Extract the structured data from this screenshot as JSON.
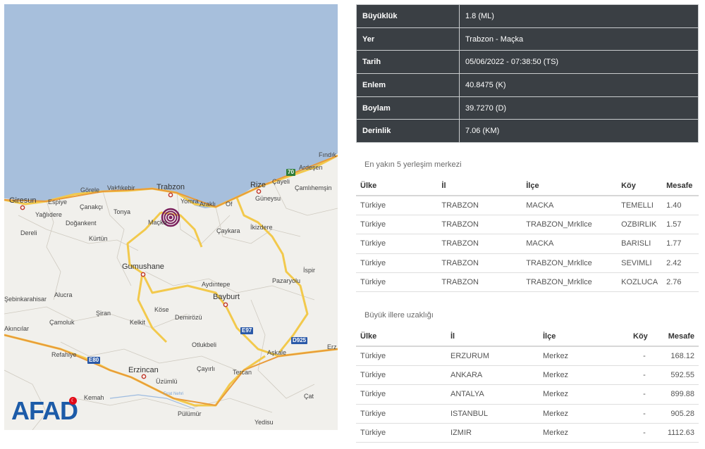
{
  "map": {
    "sea_color": "#a7bfdc",
    "land_color": "#f1f0ec",
    "epicenter_icon": "earthquake-epicenter-icon",
    "labels": {
      "findik": "Fındık",
      "ardesen": "Ardeşen",
      "rize": "Rize",
      "cayeli": "Çayeli",
      "camlihemsin": "Çamlıhemşin",
      "giresun": "Giresun",
      "espiye": "Espiye",
      "gorele": "Görele",
      "vakfikebir": "Vakfıkebir",
      "trabzon": "Trabzon",
      "yomra": "Yomra",
      "arakli": "Araklı",
      "of": "Of",
      "guneysu": "Güneysu",
      "canakci": "Çanakçı",
      "tonya": "Tonya",
      "yaglidere": "Yağlıdere",
      "dogankent": "Doğankent",
      "macka": "Maçka",
      "caykara": "Çaykara",
      "ikizdere": "İkizdere",
      "dereli": "Dereli",
      "kurtun": "Kürtün",
      "gumushane": "Gumushane",
      "ispir": "İspir",
      "sebinkarahisar": "Şebinkarahisar",
      "alucra": "Alucra",
      "aydintepe": "Aydıntepe",
      "pazaryolu": "Pazaryolu",
      "bayburt": "Bayburt",
      "siran": "Şiran",
      "kose": "Köse",
      "kelkit": "Kelkit",
      "demirozu": "Demirözü",
      "akincilar": "Akıncılar",
      "camoluk": "Çamoluk",
      "otlukbeli": "Otlukbeli",
      "refahiye": "Refahiye",
      "askale": "Aşkale",
      "erzincan": "Erzincan",
      "cayirli": "Çayırlı",
      "tercan": "Tercan",
      "uzumlu": "Üzümlü",
      "firat_nehri": "Fırat Nehri",
      "kemah": "Kemah",
      "cat": "Çat",
      "pulumur": "Pülümür",
      "yedisu": "Yedisu",
      "erz": "Erz"
    },
    "road_badges": {
      "r70": "70",
      "e97": "E97",
      "d925": "D925",
      "e80": "E80"
    },
    "logo_text": "AFAD",
    "flag_icon": "turkish-flag-icon"
  },
  "info": [
    {
      "label": "Büyüklük",
      "value": "1.8 (ML)"
    },
    {
      "label": "Yer",
      "value": "Trabzon - Maçka"
    },
    {
      "label": "Tarih",
      "value": "05/06/2022 - 07:38:50 (TS)"
    },
    {
      "label": "Enlem",
      "value": "40.8475 (K)"
    },
    {
      "label": "Boylam",
      "value": "39.7270 (D)"
    },
    {
      "label": "Derinlik",
      "value": "7.06 (KM)"
    }
  ],
  "nearest": {
    "title": "En yakın 5 yerleşim merkezi",
    "headers": [
      "Ülke",
      "İl",
      "İlçe",
      "Köy",
      "Mesafe"
    ],
    "rows": [
      [
        "Türkiye",
        "TRABZON",
        "MACKA",
        "TEMELLI",
        "1.40"
      ],
      [
        "Türkiye",
        "TRABZON",
        "TRABZON_Mrkllce",
        "OZBIRLIK",
        "1.57"
      ],
      [
        "Türkiye",
        "TRABZON",
        "MACKA",
        "BARISLI",
        "1.77"
      ],
      [
        "Türkiye",
        "TRABZON",
        "TRABZON_Mrkllce",
        "SEVIMLI",
        "2.42"
      ],
      [
        "Türkiye",
        "TRABZON",
        "TRABZON_Mrkllce",
        "KOZLUCA",
        "2.76"
      ]
    ]
  },
  "cities": {
    "title": "Büyük illere uzaklığı",
    "headers": [
      "Ülke",
      "İl",
      "İlçe",
      "Köy",
      "Mesafe"
    ],
    "rows": [
      [
        "Türkiye",
        "ERZURUM",
        "Merkez",
        "-",
        "168.12"
      ],
      [
        "Türkiye",
        "ANKARA",
        "Merkez",
        "-",
        "592.55"
      ],
      [
        "Türkiye",
        "ANTALYA",
        "Merkez",
        "-",
        "899.88"
      ],
      [
        "Türkiye",
        "ISTANBUL",
        "Merkez",
        "-",
        "905.28"
      ],
      [
        "Türkiye",
        "IZMIR",
        "Merkez",
        "-",
        "1112.63"
      ]
    ]
  }
}
